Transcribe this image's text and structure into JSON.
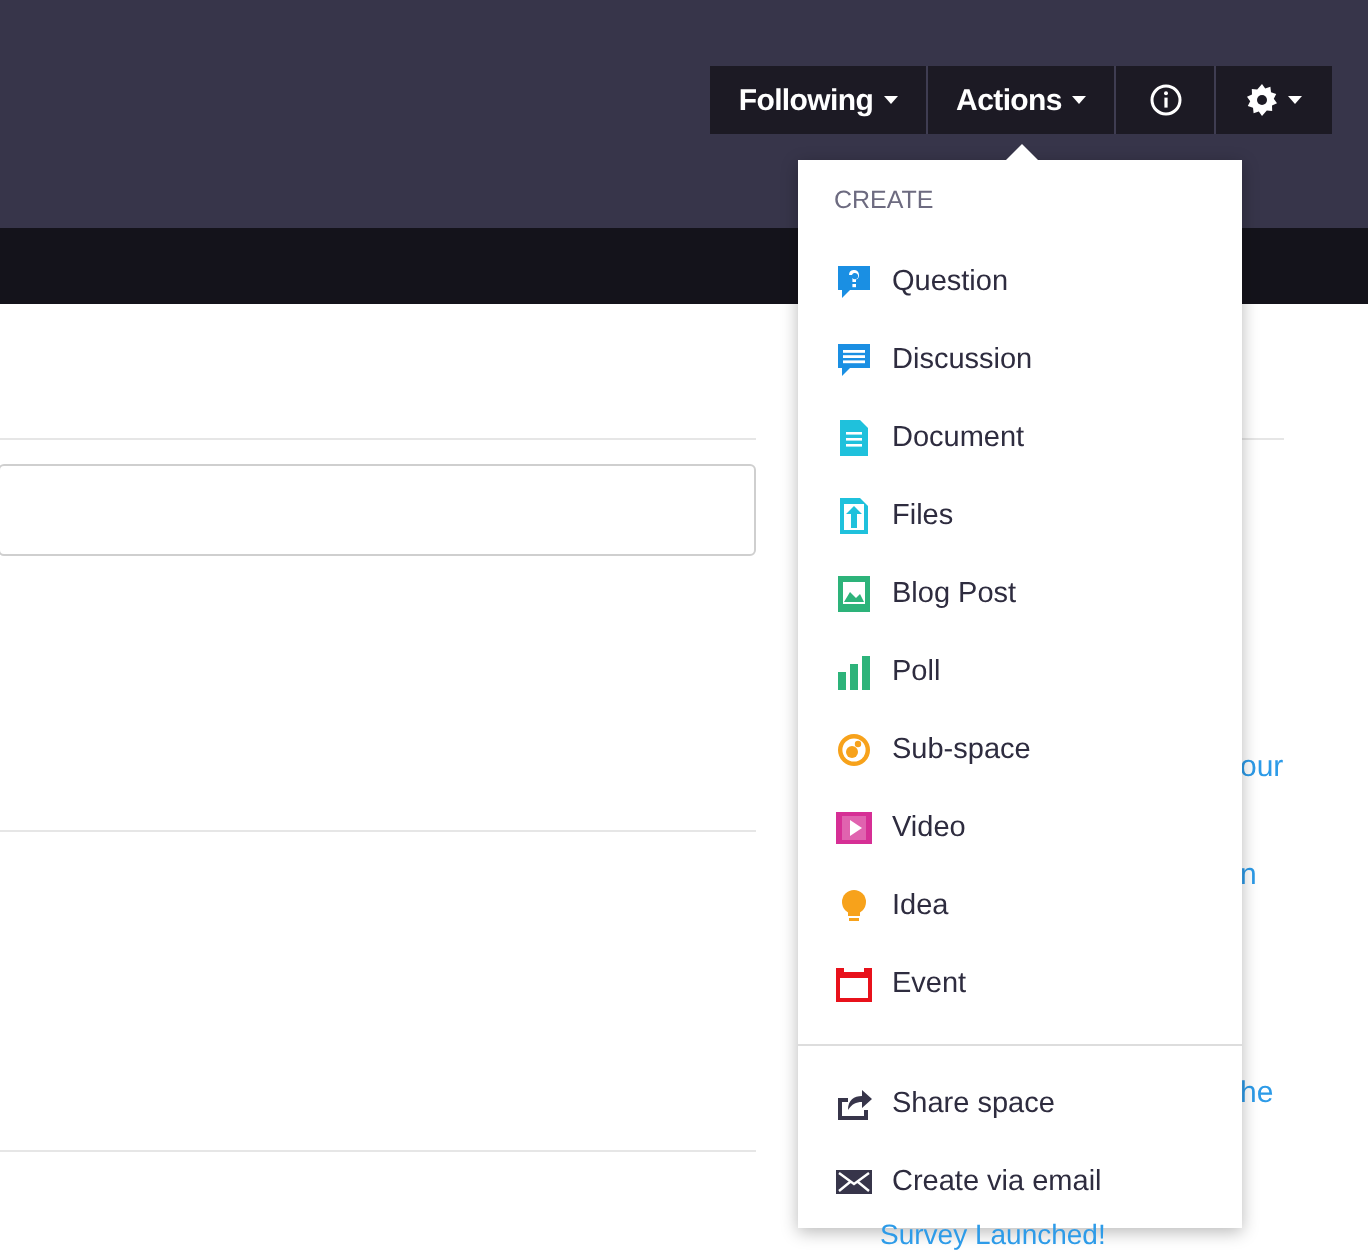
{
  "nav": [
    {
      "label": "Following",
      "kind": "text"
    },
    {
      "label": "Actions",
      "kind": "text"
    },
    {
      "kind": "info"
    },
    {
      "kind": "gear"
    }
  ],
  "menu": {
    "heading": "CREATE",
    "items": [
      {
        "label": "Question",
        "kind": "question",
        "color": "#1a8fe3"
      },
      {
        "label": "Discussion",
        "kind": "discussion",
        "color": "#1a8fe3"
      },
      {
        "label": "Document",
        "kind": "document",
        "color": "#1fc1dc"
      },
      {
        "label": "Files",
        "kind": "files",
        "color": "#1fc1dc"
      },
      {
        "label": "Blog Post",
        "kind": "blog",
        "color": "#2db37a"
      },
      {
        "label": "Poll",
        "kind": "poll",
        "color": "#2db37a"
      },
      {
        "label": "Sub-space",
        "kind": "subspace",
        "color": "#f7a21b"
      },
      {
        "label": "Video",
        "kind": "video",
        "color": "#d62f95"
      },
      {
        "label": "Idea",
        "kind": "idea",
        "color": "#f7a21b"
      },
      {
        "label": "Event",
        "kind": "event",
        "color": "#e8111b"
      }
    ],
    "actions": [
      {
        "label": "Share space",
        "kind": "share"
      },
      {
        "label": "Create via email",
        "kind": "email"
      }
    ]
  },
  "side_links": [
    "our",
    "n",
    "he"
  ],
  "bottom_link": "Survey Launched!"
}
